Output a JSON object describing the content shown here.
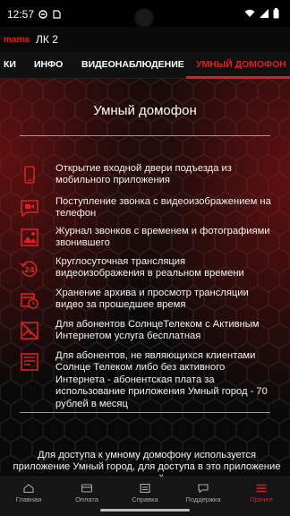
{
  "status": {
    "time": "12:57"
  },
  "header": {
    "brand": "mama",
    "account": "ЛК 2"
  },
  "tabs": [
    {
      "label": "КИ"
    },
    {
      "label": "ИНФО"
    },
    {
      "label": "ВИДЕОНАБЛЮДЕНИЕ"
    },
    {
      "label": "УМНЫЙ ДОМОФОН",
      "active": true
    }
  ],
  "page": {
    "title": "Умный домофон",
    "features": [
      {
        "icon": "phone-icon",
        "text": "Открытие входной двери подъезда из мобильного приложения"
      },
      {
        "icon": "video-call-icon",
        "text": "Поступление звонка с видеоизображением на телефон"
      },
      {
        "icon": "image-log-icon",
        "text": "Журнал звонков с временем и фотографиями звонившего"
      },
      {
        "icon": "24h-icon",
        "text": "Круглосуточная трансляция видеоизображения в реальном времени"
      },
      {
        "icon": "calendar-clock-icon",
        "text": "Хранение архива и просмотр трансляции видео за прошедшее время"
      },
      {
        "icon": "no-image-icon",
        "text": "Для абонентов СолнцеТелеком с Активным Интернетом услуга бесплатная"
      },
      {
        "icon": "pay-icon",
        "text": "Для абонентов, не являющихся клиентами Солнце Телеком либо без активного Интернета - абонентская плата за использование приложения Умный город - 70 рублей в месяц"
      }
    ],
    "access_text": "Для доступа к умному домофону используется приложение Умный город, для доступа в это приложение используйте:"
  },
  "bottom_nav": [
    {
      "label": "Главная",
      "icon": "home-icon"
    },
    {
      "label": "Оплата",
      "icon": "card-icon"
    },
    {
      "label": "Справка",
      "icon": "info-icon"
    },
    {
      "label": "Поддержка",
      "icon": "chat-icon"
    },
    {
      "label": "Прочее",
      "icon": "menu-icon",
      "active": true
    }
  ],
  "colors": {
    "accent": "#e01e1e",
    "background": "#0a0a0a"
  }
}
